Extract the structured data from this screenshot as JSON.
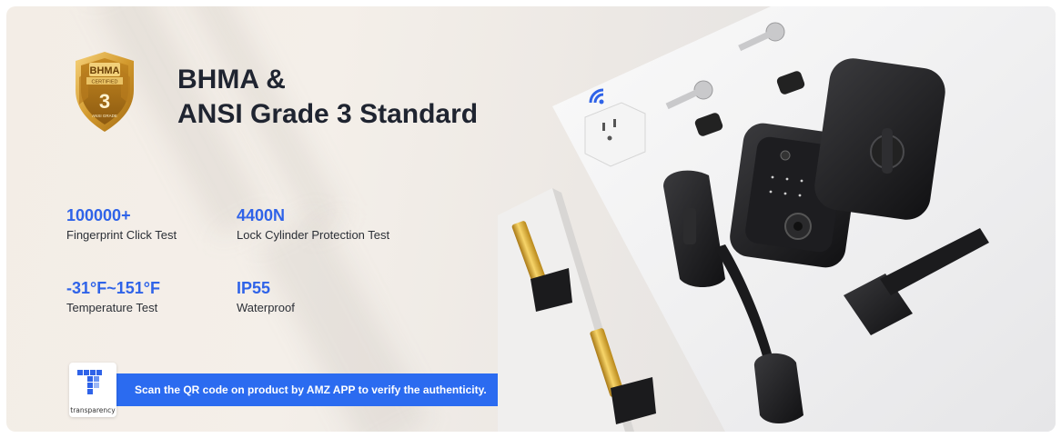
{
  "badge": {
    "top_text": "BHMA",
    "sub_text": "CERTIFIED",
    "grade_number": "3",
    "bottom_text": "ANSI GRADE"
  },
  "headline": {
    "line1": "BHMA &",
    "line2": "ANSI Grade 3 Standard"
  },
  "stats": [
    {
      "value": "100000+",
      "label": "Fingerprint Click Test"
    },
    {
      "value": "4400N",
      "label": "Lock Cylinder Protection Test"
    },
    {
      "value": "-31°F~151°F",
      "label": "Temperature Test"
    },
    {
      "value": "IP55",
      "label": "Waterproof"
    }
  ],
  "transparency": {
    "label": "transparency"
  },
  "scan_message": "Scan the QR code on product by AMZ APP to verify the authenticity.",
  "colors": {
    "accent_blue": "#2f63e8",
    "pill_blue": "#2b6bf0",
    "gold": "#d9a232",
    "lock_black": "#1c1c1e"
  },
  "icons": [
    "bhma-badge-icon",
    "wifi-icon",
    "transparency-logo-icon"
  ]
}
